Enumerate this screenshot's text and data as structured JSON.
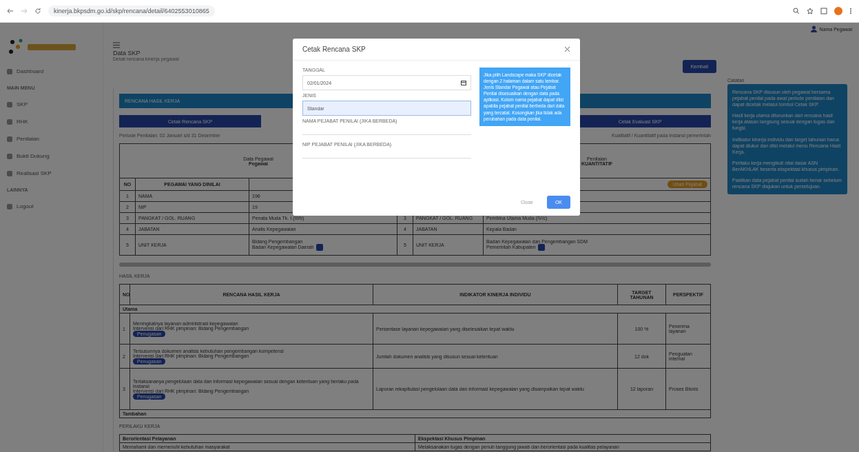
{
  "browser": {
    "url": "kinerja.bkpsdm.go.id/skp/rencana/detail/6402553010865"
  },
  "sidebar": {
    "items": [
      {
        "kind": "item",
        "label": "Dashboard"
      },
      {
        "kind": "section",
        "label": "MAIN MENU"
      },
      {
        "kind": "item",
        "label": "SKP"
      },
      {
        "kind": "item",
        "label": "RHK"
      },
      {
        "kind": "item",
        "label": "Penilaian"
      },
      {
        "kind": "item",
        "label": "Bukti Dukung"
      },
      {
        "kind": "item",
        "label": "Realisasi SKP"
      },
      {
        "kind": "section",
        "label": "LAINNYA"
      },
      {
        "kind": "item",
        "label": "Logout"
      }
    ]
  },
  "header": {
    "title": "Data SKP",
    "subtitle": "Detail rencana kinerja pegawai",
    "user": "Nama Pegawai",
    "back_button": "Kembali"
  },
  "note_panel": {
    "title": "Catatan",
    "paragraphs": [
      "Rencana SKP disusun oleh pegawai bersama pejabat penilai pada awal periode penilaian dan dapat dicetak melalui tombol Cetak SKP.",
      "Hasil kerja utama diturunkan dari rencana hasil kerja atasan langsung sesuai dengan tugas dan fungsi.",
      "Indikator kinerja individu dan target tahunan harus dapat diukur dan diisi melalui menu Rencana Hasil Kerja.",
      "Perilaku kerja mengikuti nilai dasar ASN BerAKHLAK beserta ekspektasi khusus pimpinan.",
      "Pastikan data pejabat penilai sudah benar sebelum rencana SKP diajukan untuk persetujuan."
    ]
  },
  "banner": "RENCANA HASIL KERJA",
  "action_buttons": [
    {
      "label": "Cetak Rencana SKP"
    },
    {
      "label": "Cetak Evaluasi SKP"
    }
  ],
  "period_left": "Periode Penilaian: 02 Januari s/d 31 Desember",
  "period_right": "Kualitatif / Kuantitatif pada instansi pemerintah",
  "officials": {
    "left_heading": "Data Pegawai",
    "left_title": "Pegawai",
    "right_heading": "Penilaian",
    "right_title": "KUANTITATIF",
    "no_label": "NO",
    "col_label": "PEGAWAI YANG DINILAI",
    "change_button": "Ubah Pejabat",
    "rows": [
      {
        "no": "1",
        "label": "NAMA",
        "value": [
          "196"
        ]
      },
      {
        "no": "2",
        "label": "NIP",
        "value": [
          "19"
        ]
      },
      {
        "no": "3",
        "label": "PANGKAT / GOL. RUANG",
        "value": [
          "Penata Muda Tk. I (III/b)"
        ],
        "right_no": "3",
        "right_label": "PANGKAT / GOL. RUANG",
        "right_value": [
          "Pembina Utama Muda (IV/c)"
        ]
      },
      {
        "no": "4",
        "label": "JABATAN",
        "value": [
          "Analis Kepegawaian"
        ],
        "right_no": "4",
        "right_label": "JABATAN",
        "right_value": [
          "Kepala Badan"
        ]
      },
      {
        "no": "5",
        "label": "UNIT KERJA",
        "value": [
          "Bidang Pengembangan",
          "Badan Kepegawaian Daerah"
        ],
        "right_no": "5",
        "right_label": "UNIT KERJA",
        "right_value": [
          "Badan Kepegawaian dan Pengembangan SDM",
          "Pemerintah Kabupaten"
        ]
      }
    ]
  },
  "work": {
    "label": "HASIL KERJA",
    "columns": [
      "NO",
      "RENCANA HASIL KERJA",
      "INDIKATOR KINERJA INDIVIDU",
      "TARGET TAHUNAN",
      "PERSPEKTIF"
    ],
    "groups": [
      {
        "title": "Utama",
        "rows": [
          {
            "no": "1",
            "plan": "Meningkatnya layanan administrasi kepegawaian",
            "parent": "Intervensi dari RHK pimpinan: Bidang Pengembangan",
            "badge": "Penugasan",
            "indicator": "Persentase layanan kepegawaian yang diselesaikan tepat waktu",
            "target": "100 %",
            "perspective": "Penerima layanan"
          },
          {
            "no": "2",
            "plan": "Tersusunnya dokumen analisis kebutuhan pengembangan kompetensi",
            "parent": "Intervensi dari RHK pimpinan: Bidang Pengembangan",
            "badge": "Penugasan",
            "indicator": "Jumlah dokumen analisis yang disusun sesuai ketentuan",
            "target": "12 dok",
            "perspective": "Penguatan internal"
          },
          {
            "no": "3",
            "plan": "Terlaksananya pengelolaan data dan informasi kepegawaian sesuai dengan ketentuan yang berlaku pada instansi",
            "parent": "Intervensi dari RHK pimpinan: Bidang Pengembangan",
            "badge": "Penugasan",
            "indicator": "Laporan rekapitulasi pengelolaan data dan informasi kepegawaian yang disampaikan tepat waktu",
            "target": "12 laporan",
            "perspective": "Proses Bisnis"
          }
        ]
      },
      {
        "title": "Tambahan"
      }
    ]
  },
  "behavior": {
    "label": "PERILAKU KERJA",
    "left_title": "Berorientasi Pelayanan",
    "right_title": "Ekspektasi Khusus Pimpinan",
    "left_item": "Memahami dan memenuhi kebutuhan masyarakat",
    "right_item": "Melaksanakan tugas dengan penuh tanggung jawab dan berorientasi pada kualitas pelayanan"
  },
  "modal": {
    "title": "Cetak Rencana SKP",
    "date_label": "TANGGAL",
    "date_value": "02/01/2024",
    "type_label": "JENIS",
    "type_value": "Standar",
    "field3_label": "NAMA PEJABAT PENILAI (JIKA BERBEDA)",
    "field4_label": "NIP PEJABAT PENILAI (JIKA BERBEDA)",
    "note": "Jika pilih Landscape maka SKP dicetak dengan 2 halaman dalam satu lembar. Jenis Standar Pegawai atau Pejabat Penilai disesuaikan dengan data pada aplikasi. Kolom nama pejabat dapat diisi apabila pejabat penilai berbeda dari data yang tercatat. Kosongkan jika tidak ada perubahan pada data penilai.",
    "close_button": "Close",
    "ok_button": "OK"
  }
}
